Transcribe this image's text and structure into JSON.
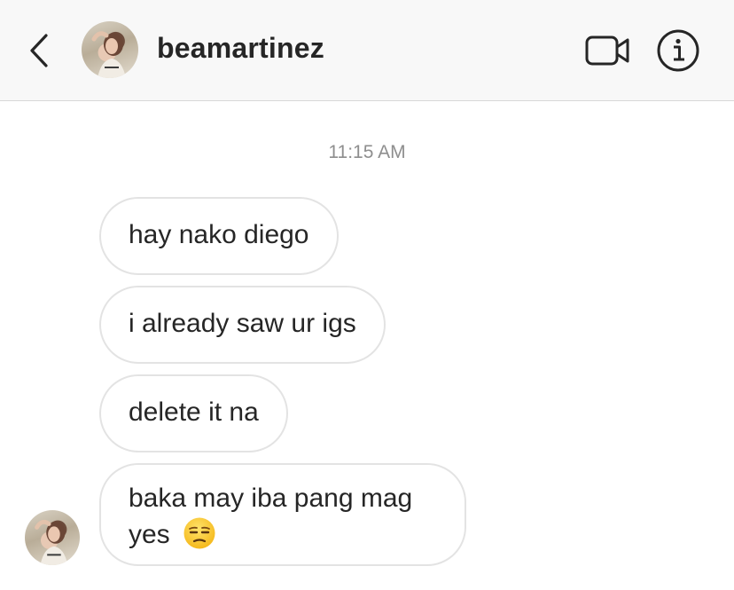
{
  "header": {
    "username": "beamartinez",
    "icons": {
      "back": "chevron-left-icon",
      "video": "video-camera-icon",
      "info": "info-circle-icon"
    }
  },
  "conversation": {
    "timestamp": "11:15 AM",
    "messages": [
      {
        "text": "hay nako diego"
      },
      {
        "text": "i already saw ur igs"
      },
      {
        "text": "delete it na"
      },
      {
        "text": "baka may iba pang mag yes",
        "emoji": "unamused-face-emoji"
      }
    ]
  },
  "colors": {
    "header_bg": "#f8f8f8",
    "bubble_border": "#e3e3e3",
    "text": "#262626",
    "timestamp": "#8e8e8e"
  }
}
